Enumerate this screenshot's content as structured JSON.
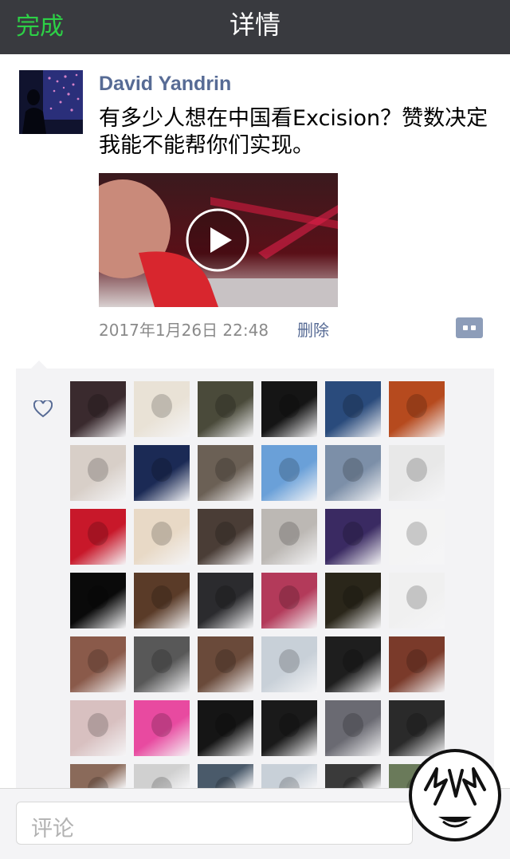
{
  "navbar": {
    "done_label": "完成",
    "title": "详情"
  },
  "post": {
    "author": "David Yandrin",
    "text": "有多少人想在中国看Excision？赞数决定我能不能帮你们实现。",
    "time": "2017年1月26日 22:48",
    "delete_label": "删除"
  },
  "likes": {
    "icon": "heart-icon",
    "avatars": [
      "#3a2a2e",
      "#e9e2d6",
      "#4a4a3a",
      "#151515",
      "#2a4b7c",
      "#b64a1e",
      "#d8cfc8",
      "#1b2a55",
      "#6b6055",
      "#6aa0d8",
      "#7c8fa8",
      "#e8e8e8",
      "#c8182a",
      "#e8d9c6",
      "#4a3d36",
      "#bcb8b4",
      "#3a2a62",
      "#f4f4f4",
      "#0a0a0a",
      "#5a3b28",
      "#2b2b2e",
      "#b33a5a",
      "#2a261a",
      "#f0f0f0",
      "#8a5a4a",
      "#585858",
      "#6a4a3a",
      "#c8d0d8",
      "#1e1e1e",
      "#7a3a2a",
      "#d8c0c0",
      "#e84aa0",
      "#151515",
      "#1a1a1a",
      "#6a6a72",
      "#2a2a2a",
      "#8a6a5a",
      "#d0d0d0",
      "#4a5a6a",
      "#c8d0d8",
      "#3a3a3a",
      "#6a7a5a"
    ]
  },
  "comment": {
    "placeholder": "评论"
  },
  "colors": {
    "accent_green": "#2dd046",
    "link_blue": "#576b95",
    "navbar_bg": "#393a3f"
  }
}
